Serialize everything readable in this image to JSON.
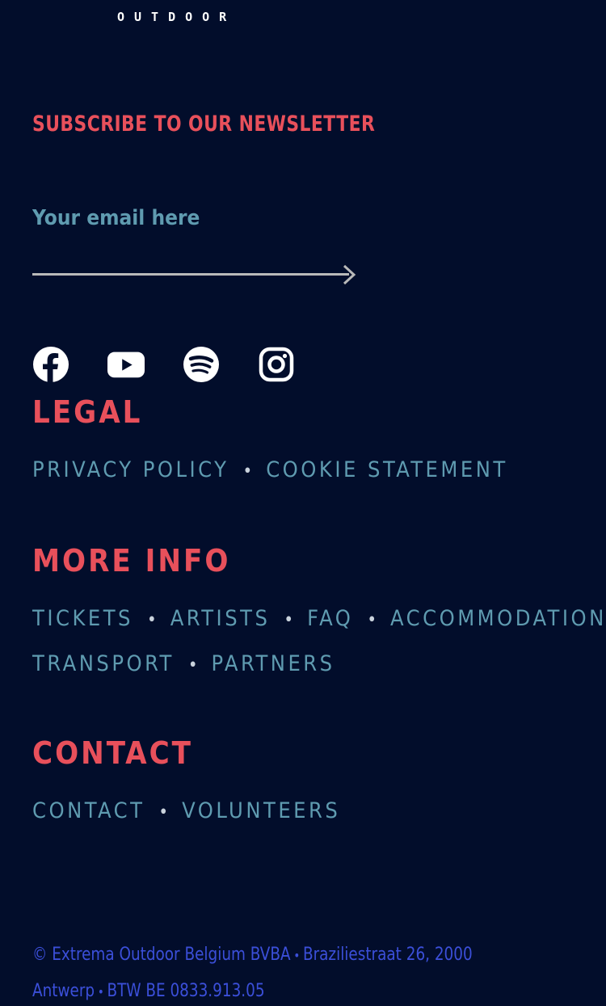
{
  "brand": {
    "logo_text": "OUTDOOR"
  },
  "newsletter": {
    "title": "SUBSCRIBE TO OUR NEWSLETTER",
    "email_placeholder": "Your email here"
  },
  "social": {
    "icons": [
      "facebook-icon",
      "youtube-icon",
      "spotify-icon",
      "instagram-icon"
    ]
  },
  "legal": {
    "heading": "LEGAL",
    "links": [
      "PRIVACY POLICY",
      "COOKIE STATEMENT"
    ]
  },
  "more_info": {
    "heading": "MORE INFO",
    "links": [
      "TICKETS",
      "ARTISTS",
      "FAQ",
      "ACCOMMODATION",
      "TRANSPORT",
      "PARTNERS"
    ]
  },
  "contact": {
    "heading": "CONTACT",
    "links": [
      "CONTACT",
      "VOLUNTEERS"
    ]
  },
  "footer": {
    "company": "© Extrema Outdoor Belgium BVBA",
    "address": "Braziliestraat 26, 2000 Antwerp",
    "vat": "BTW BE 0833.913.05"
  },
  "colors": {
    "background": "#020d2b",
    "accent": "#e8505b",
    "link": "#5f9bb0",
    "footer_text": "#3b4fd9",
    "icon": "#ffffff"
  }
}
